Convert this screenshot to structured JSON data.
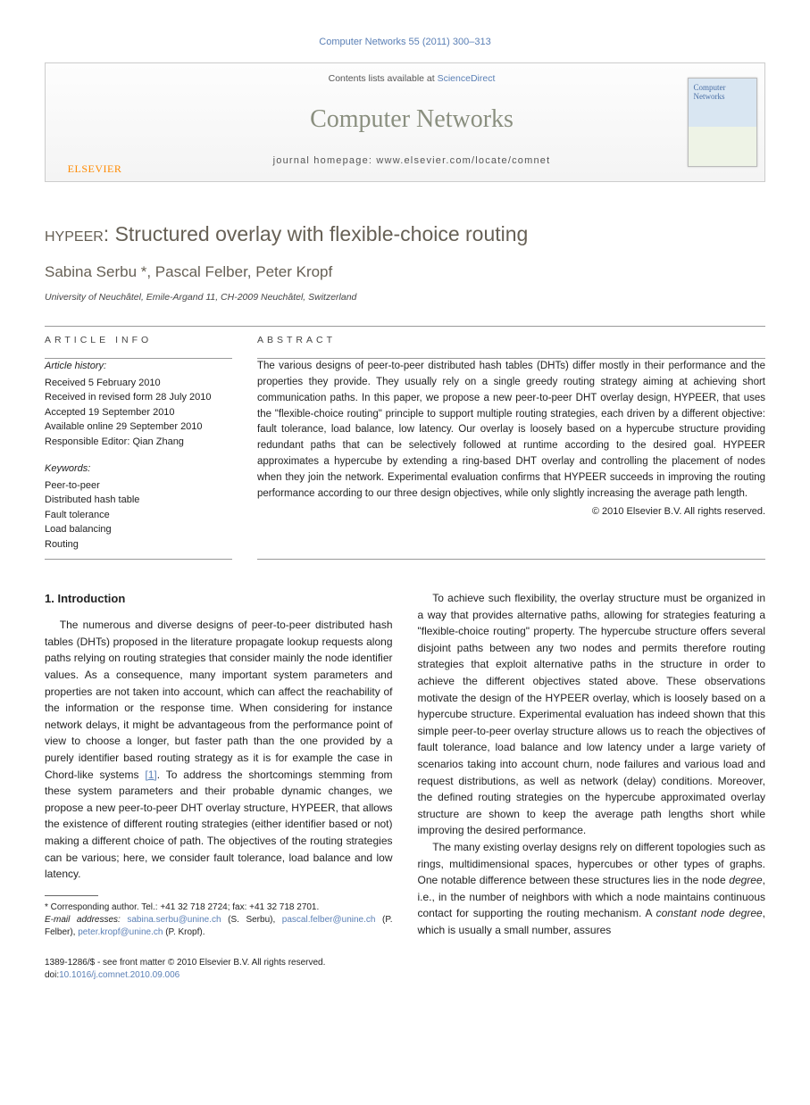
{
  "top_citation": "Computer Networks 55 (2011) 300–313",
  "banner": {
    "contents_line_prefix": "Contents lists available at ",
    "contents_link": "ScienceDirect",
    "journal_name": "Computer Networks",
    "homepage_line": "journal homepage: www.elsevier.com/locate/comnet",
    "publisher_label": "ELSEVIER",
    "cover_title": "Computer Networks"
  },
  "article": {
    "title_prefix_sc": "hypeer",
    "title_rest": ": Structured overlay with flexible-choice routing",
    "authors_line": "Sabina Serbu *, Pascal Felber, Peter Kropf",
    "affiliation": "University of Neuchâtel, Emile-Argand 11, CH-2009 Neuchâtel, Switzerland"
  },
  "info": {
    "article_info_label": "article info",
    "abstract_label": "abstract",
    "history_head": "Article history:",
    "history_items": [
      "Received 5 February 2010",
      "Received in revised form 28 July 2010",
      "Accepted 19 September 2010",
      "Available online 29 September 2010",
      "Responsible Editor: Qian Zhang"
    ],
    "keywords_head": "Keywords:",
    "keywords": [
      "Peer-to-peer",
      "Distributed hash table",
      "Fault tolerance",
      "Load balancing",
      "Routing"
    ],
    "abstract_text": "The various designs of peer-to-peer distributed hash tables (DHTs) differ mostly in their performance and the properties they provide. They usually rely on a single greedy routing strategy aiming at achieving short communication paths. In this paper, we propose a new peer-to-peer DHT overlay design, HYPEER, that uses the \"flexible-choice routing\" principle to support multiple routing strategies, each driven by a different objective: fault tolerance, load balance, low latency. Our overlay is loosely based on a hypercube structure providing redundant paths that can be selectively followed at runtime according to the desired goal. HYPEER approximates a hypercube by extending a ring-based DHT overlay and controlling the placement of nodes when they join the network. Experimental evaluation confirms that HYPEER succeeds in improving the routing performance according to our three design objectives, while only slightly increasing the average path length.",
    "copyright": "© 2010 Elsevier B.V. All rights reserved."
  },
  "body": {
    "section_heading": "1. Introduction",
    "p1a": "The numerous and diverse designs of peer-to-peer distributed hash tables (DHTs) proposed in the literature propagate lookup requests along paths relying on routing strategies that consider mainly the node identifier values. As a consequence, many important system parameters and properties are not taken into account, which can affect the reachability of the information or the response time. When considering for instance network delays, it might be advantageous from the performance point of view to choose a longer, but faster path than the one provided by a purely identifier based routing strategy as it is for example the case in Chord-like systems ",
    "ref1": "[1]",
    "p1b": ". To address the shortcomings stemming from these system parameters and their probable dynamic changes, we propose a new peer-to-peer DHT overlay structure, HYPEER, that allows the existence of different routing strategies (either identifier based or not) making a different choice of path. The objectives of the routing strategies can be various; here, we consider fault tolerance, load balance and low latency.",
    "p2": "To achieve such flexibility, the overlay structure must be organized in a way that provides alternative paths, allowing for strategies featuring a \"flexible-choice routing\" property. The hypercube structure offers several disjoint paths between any two nodes and permits therefore routing strategies that exploit alternative paths in the structure in order to achieve the different objectives stated above. These observations motivate the design of the HYPEER overlay, which is loosely based on a hypercube structure. Experimental evaluation has indeed shown that this simple peer-to-peer overlay structure allows us to reach the objectives of fault tolerance, load balance and low latency under a large variety of scenarios taking into account churn, node failures and various load and request distributions, as well as network (delay) conditions. Moreover, the defined routing strategies on the hypercube approximated overlay structure are shown to keep the average path lengths short while improving the desired performance.",
    "p3a": "The many existing overlay designs rely on different topologies such as rings, multidimensional spaces, hypercubes or other types of graphs. One notable difference between these structures lies in the node ",
    "degree_word": "degree",
    "p3b": ", i.e., in the number of neighbors with which a node maintains continuous contact for supporting the routing mechanism. A ",
    "const_deg": "constant node degree",
    "p3c": ", which is usually a small number, assures"
  },
  "footnotes": {
    "corr": "* Corresponding author. Tel.: +41 32 718 2724; fax: +41 32 718 2701.",
    "email_label": "E-mail addresses:",
    "emails": [
      {
        "addr": "sabina.serbu@unine.ch",
        "who": " (S. Serbu), "
      },
      {
        "addr": "pascal.felber@unine.ch",
        "who": " (P. Felber), "
      },
      {
        "addr": "peter.kropf@unine.ch",
        "who": " (P. Kropf)."
      }
    ]
  },
  "bottom": {
    "issn_line": "1389-1286/$ - see front matter © 2010 Elsevier B.V. All rights reserved.",
    "doi_label": "doi:",
    "doi": "10.1016/j.comnet.2010.09.006"
  }
}
